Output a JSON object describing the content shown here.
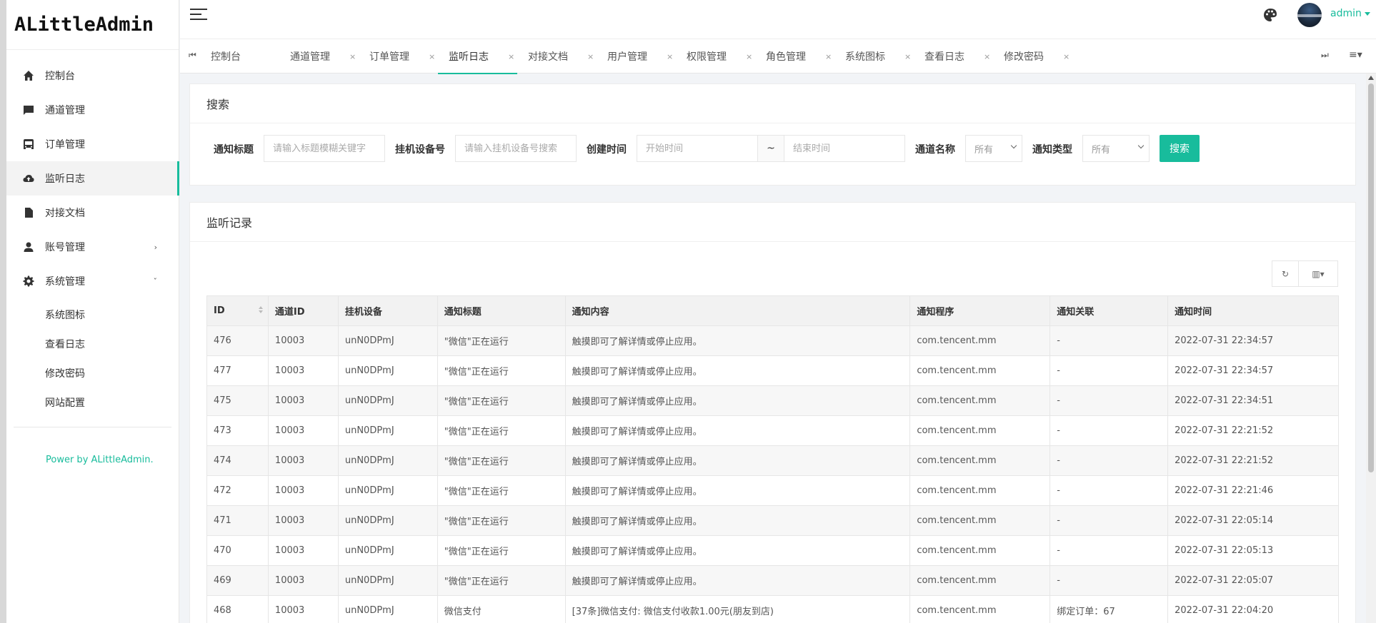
{
  "app": {
    "logo": "ALittleAdmin",
    "power": "Power by ALittleAdmin."
  },
  "sidebar": {
    "items": [
      {
        "label": "控制台",
        "icon": "home-icon"
      },
      {
        "label": "通道管理",
        "icon": "chat-icon"
      },
      {
        "label": "订单管理",
        "icon": "order-icon"
      },
      {
        "label": "监听日志",
        "icon": "cloud-icon",
        "active": true
      },
      {
        "label": "对接文档",
        "icon": "document-icon"
      },
      {
        "label": "账号管理",
        "icon": "user-icon",
        "chevron": "›"
      },
      {
        "label": "系统管理",
        "icon": "gear-icon",
        "chevron": "ˇ"
      }
    ],
    "sub_items": [
      "系统图标",
      "查看日志",
      "修改密码",
      "网站配置"
    ]
  },
  "header": {
    "user": "admin"
  },
  "tabs": {
    "items": [
      "控制台",
      "通道管理",
      "订单管理",
      "监听日志",
      "对接文档",
      "用户管理",
      "权限管理",
      "角色管理",
      "系统图标",
      "查看日志",
      "修改密码"
    ],
    "close": "×",
    "first_glyph": "⏮",
    "last_glyph": "⏭",
    "menu_glyph": "≡▾"
  },
  "search": {
    "title": "搜索",
    "title_label": "通知标题",
    "title_placeholder": "请输入标题模糊关键字",
    "device_label": "挂机设备号",
    "device_placeholder": "请输入挂机设备号搜索",
    "time_label": "创建时间",
    "start_placeholder": "开始时间",
    "tilde": "~",
    "end_placeholder": "结束时间",
    "channel_label": "通道名称",
    "channel_value": "所有",
    "type_label": "通知类型",
    "type_value": "所有",
    "button": "搜索"
  },
  "records": {
    "title": "监听记录",
    "refresh_glyph": "↻",
    "columns_glyph": "▥▾",
    "columns": [
      "ID",
      "通道ID",
      "挂机设备",
      "通知标题",
      "通知内容",
      "通知程序",
      "通知关联",
      "通知时间"
    ],
    "rows": [
      [
        "476",
        "10003",
        "unN0DPmJ",
        "\"微信\"正在运行",
        "触摸即可了解详情或停止应用。",
        "com.tencent.mm",
        "-",
        "2022-07-31 22:34:57"
      ],
      [
        "477",
        "10003",
        "unN0DPmJ",
        "\"微信\"正在运行",
        "触摸即可了解详情或停止应用。",
        "com.tencent.mm",
        "-",
        "2022-07-31 22:34:57"
      ],
      [
        "475",
        "10003",
        "unN0DPmJ",
        "\"微信\"正在运行",
        "触摸即可了解详情或停止应用。",
        "com.tencent.mm",
        "-",
        "2022-07-31 22:34:51"
      ],
      [
        "473",
        "10003",
        "unN0DPmJ",
        "\"微信\"正在运行",
        "触摸即可了解详情或停止应用。",
        "com.tencent.mm",
        "-",
        "2022-07-31 22:21:52"
      ],
      [
        "474",
        "10003",
        "unN0DPmJ",
        "\"微信\"正在运行",
        "触摸即可了解详情或停止应用。",
        "com.tencent.mm",
        "-",
        "2022-07-31 22:21:52"
      ],
      [
        "472",
        "10003",
        "unN0DPmJ",
        "\"微信\"正在运行",
        "触摸即可了解详情或停止应用。",
        "com.tencent.mm",
        "-",
        "2022-07-31 22:21:46"
      ],
      [
        "471",
        "10003",
        "unN0DPmJ",
        "\"微信\"正在运行",
        "触摸即可了解详情或停止应用。",
        "com.tencent.mm",
        "-",
        "2022-07-31 22:05:14"
      ],
      [
        "470",
        "10003",
        "unN0DPmJ",
        "\"微信\"正在运行",
        "触摸即可了解详情或停止应用。",
        "com.tencent.mm",
        "-",
        "2022-07-31 22:05:13"
      ],
      [
        "469",
        "10003",
        "unN0DPmJ",
        "\"微信\"正在运行",
        "触摸即可了解详情或停止应用。",
        "com.tencent.mm",
        "-",
        "2022-07-31 22:05:07"
      ],
      [
        "468",
        "10003",
        "unN0DPmJ",
        "微信支付",
        "[37条]微信支付: 微信支付收款1.00元(朋友到店)",
        "com.tencent.mm",
        "绑定订单：67",
        "2022-07-31 22:04:20"
      ]
    ]
  },
  "colors": {
    "accent": "#18bc9c"
  }
}
